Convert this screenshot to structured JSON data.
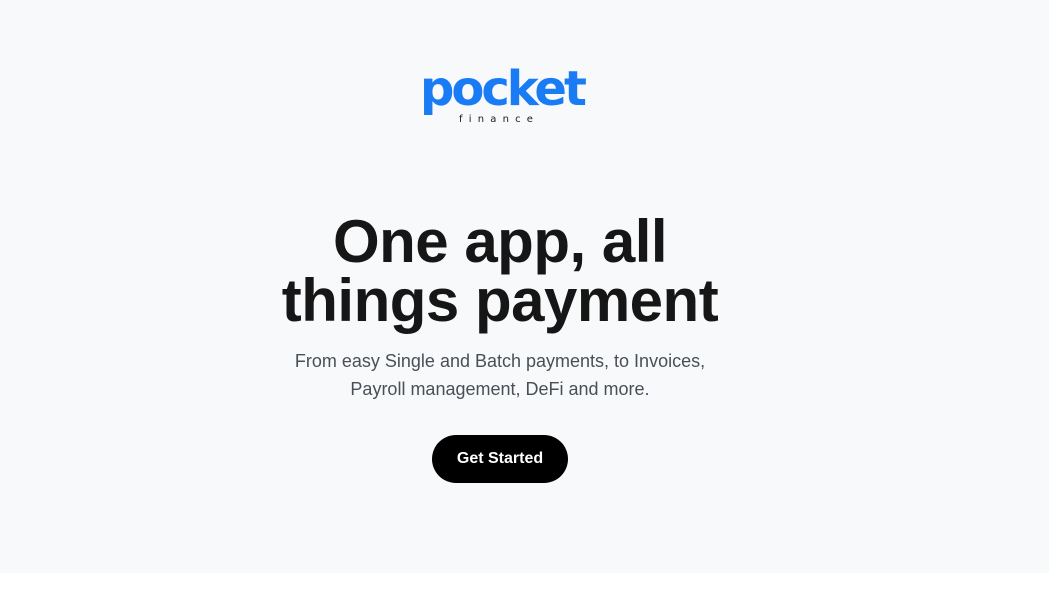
{
  "logo": {
    "word": "pocket",
    "sub": "finance",
    "color": "#1a7cf5"
  },
  "hero": {
    "headline_line1": "One app, all",
    "headline_line2": "things payment",
    "subtext_line1": "From easy Single and Batch payments, to Invoices,",
    "subtext_line2": "Payroll management, DeFi and more.",
    "cta_label": "Get Started"
  },
  "colors": {
    "background": "#f8f9fb",
    "headline": "#161616",
    "subtext": "#4a4f57",
    "button_bg": "#000000",
    "button_text": "#ffffff"
  }
}
